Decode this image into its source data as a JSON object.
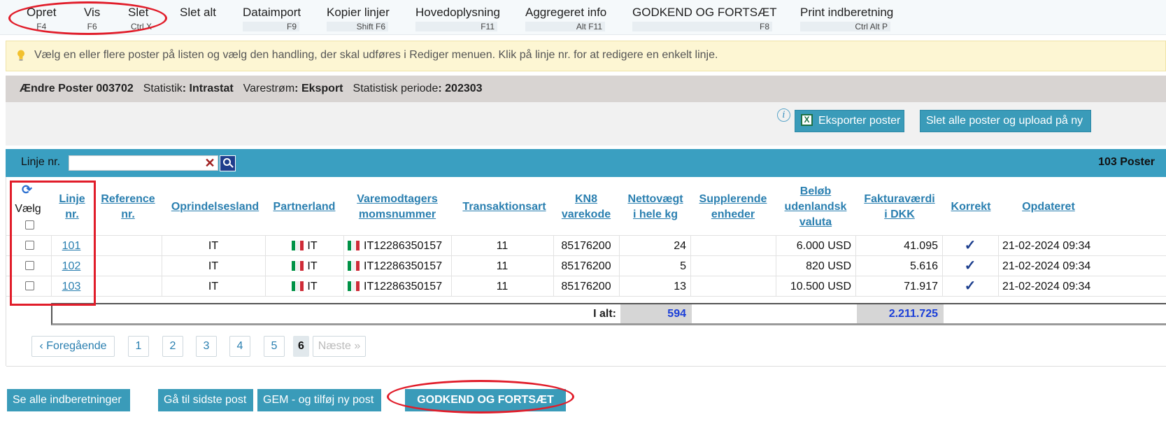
{
  "toolbar": {
    "items": [
      {
        "label": "Opret",
        "shortcut": "F4"
      },
      {
        "label": "Vis",
        "shortcut": "F6"
      },
      {
        "label": "Slet",
        "shortcut": "Ctrl X"
      },
      {
        "label": "Slet alt",
        "shortcut": ""
      },
      {
        "label": "Dataimport",
        "shortcut": "F9"
      },
      {
        "label": "Kopier linjer",
        "shortcut": "Shift F6"
      },
      {
        "label": "Hovedoplysning",
        "shortcut": "F11"
      },
      {
        "label": "Aggregeret info",
        "shortcut": "Alt F11"
      },
      {
        "label": "GODKEND OG FORTSÆT",
        "shortcut": "F8"
      },
      {
        "label": "Print indberetning",
        "shortcut": "Ctrl Alt P"
      }
    ]
  },
  "info": {
    "icon": "lightbulb-icon",
    "text": "Vælg en eller flere poster på listen og vælg den handling, der skal udføres i Rediger menuen. Klik på linje nr. for at redigere en enkelt linje."
  },
  "header": {
    "title": "Ændre Poster 003702",
    "statistik_label": "Statistik",
    "statistik_value": "Intrastat",
    "varestrom_label": "Varestrøm",
    "varestrom_value": "Eksport",
    "periode_label": "Statistisk periode",
    "periode_value": "202303"
  },
  "actions": {
    "export_label": "Eksporter poster",
    "delete_upload_label": "Slet alle poster og upload på ny"
  },
  "filter": {
    "label": "Linje nr.",
    "value": "",
    "count": "103 Poster"
  },
  "table": {
    "columns": {
      "vaelg": "Vælg",
      "linje": [
        "Linje",
        "nr."
      ],
      "reference": [
        "Reference",
        "nr."
      ],
      "oprindelsesland": "Oprindelsesland",
      "partnerland": "Partnerland",
      "varemodtagers": [
        "Varemodtagers",
        "momsnummer"
      ],
      "transaktionsart": "Transaktionsart",
      "kn8": [
        "KN8",
        "varekode"
      ],
      "nettovaegt": [
        "Nettovægt",
        "i hele kg"
      ],
      "supplerende": [
        "Supplerende",
        "enheder"
      ],
      "belob": [
        "Beløb",
        "udenlandsk",
        "valuta"
      ],
      "faktura": [
        "Fakturaværdi",
        "i DKK"
      ],
      "korrekt": "Korrekt",
      "opdateret": "Opdateret"
    },
    "rows": [
      {
        "linje": "101",
        "reference": "",
        "oprindelsesland": "IT",
        "partnerland": "IT",
        "moms": "IT12286350157",
        "transaktionsart": "11",
        "kn8": "85176200",
        "nettovaegt": "24",
        "supplerende": "",
        "belob": "6.000 USD",
        "faktura": "41.095",
        "korrekt": "✓",
        "opdateret": "21-02-2024 09:34"
      },
      {
        "linje": "102",
        "reference": "",
        "oprindelsesland": "IT",
        "partnerland": "IT",
        "moms": "IT12286350157",
        "transaktionsart": "11",
        "kn8": "85176200",
        "nettovaegt": "5",
        "supplerende": "",
        "belob": "820 USD",
        "faktura": "5.616",
        "korrekt": "✓",
        "opdateret": "21-02-2024 09:34"
      },
      {
        "linje": "103",
        "reference": "",
        "oprindelsesland": "IT",
        "partnerland": "IT",
        "moms": "IT12286350157",
        "transaktionsart": "11",
        "kn8": "85176200",
        "nettovaegt": "13",
        "supplerende": "",
        "belob": "10.500 USD",
        "faktura": "71.917",
        "korrekt": "✓",
        "opdateret": "21-02-2024 09:34"
      }
    ],
    "total_label": "I alt:",
    "total_nettovaegt": "594",
    "total_faktura": "2.211.725"
  },
  "pagination": {
    "prev": "‹ Foregående",
    "pages": [
      "1",
      "2",
      "3",
      "4",
      "5",
      "6"
    ],
    "current": "6",
    "next": "Næste »"
  },
  "bottom": {
    "see_all": "Se alle indberetninger",
    "goto_last": "Gå til sidste post",
    "save_add": "GEM - og tilføj ny post",
    "approve": "GODKEND OG FORTSÆT"
  },
  "colors": {
    "accent": "#3a9bb9",
    "link": "#2a7fb0",
    "annotation": "#e11d2a",
    "flag_green": "#009246",
    "flag_white": "#ffffff",
    "flag_red": "#ce2b37"
  }
}
